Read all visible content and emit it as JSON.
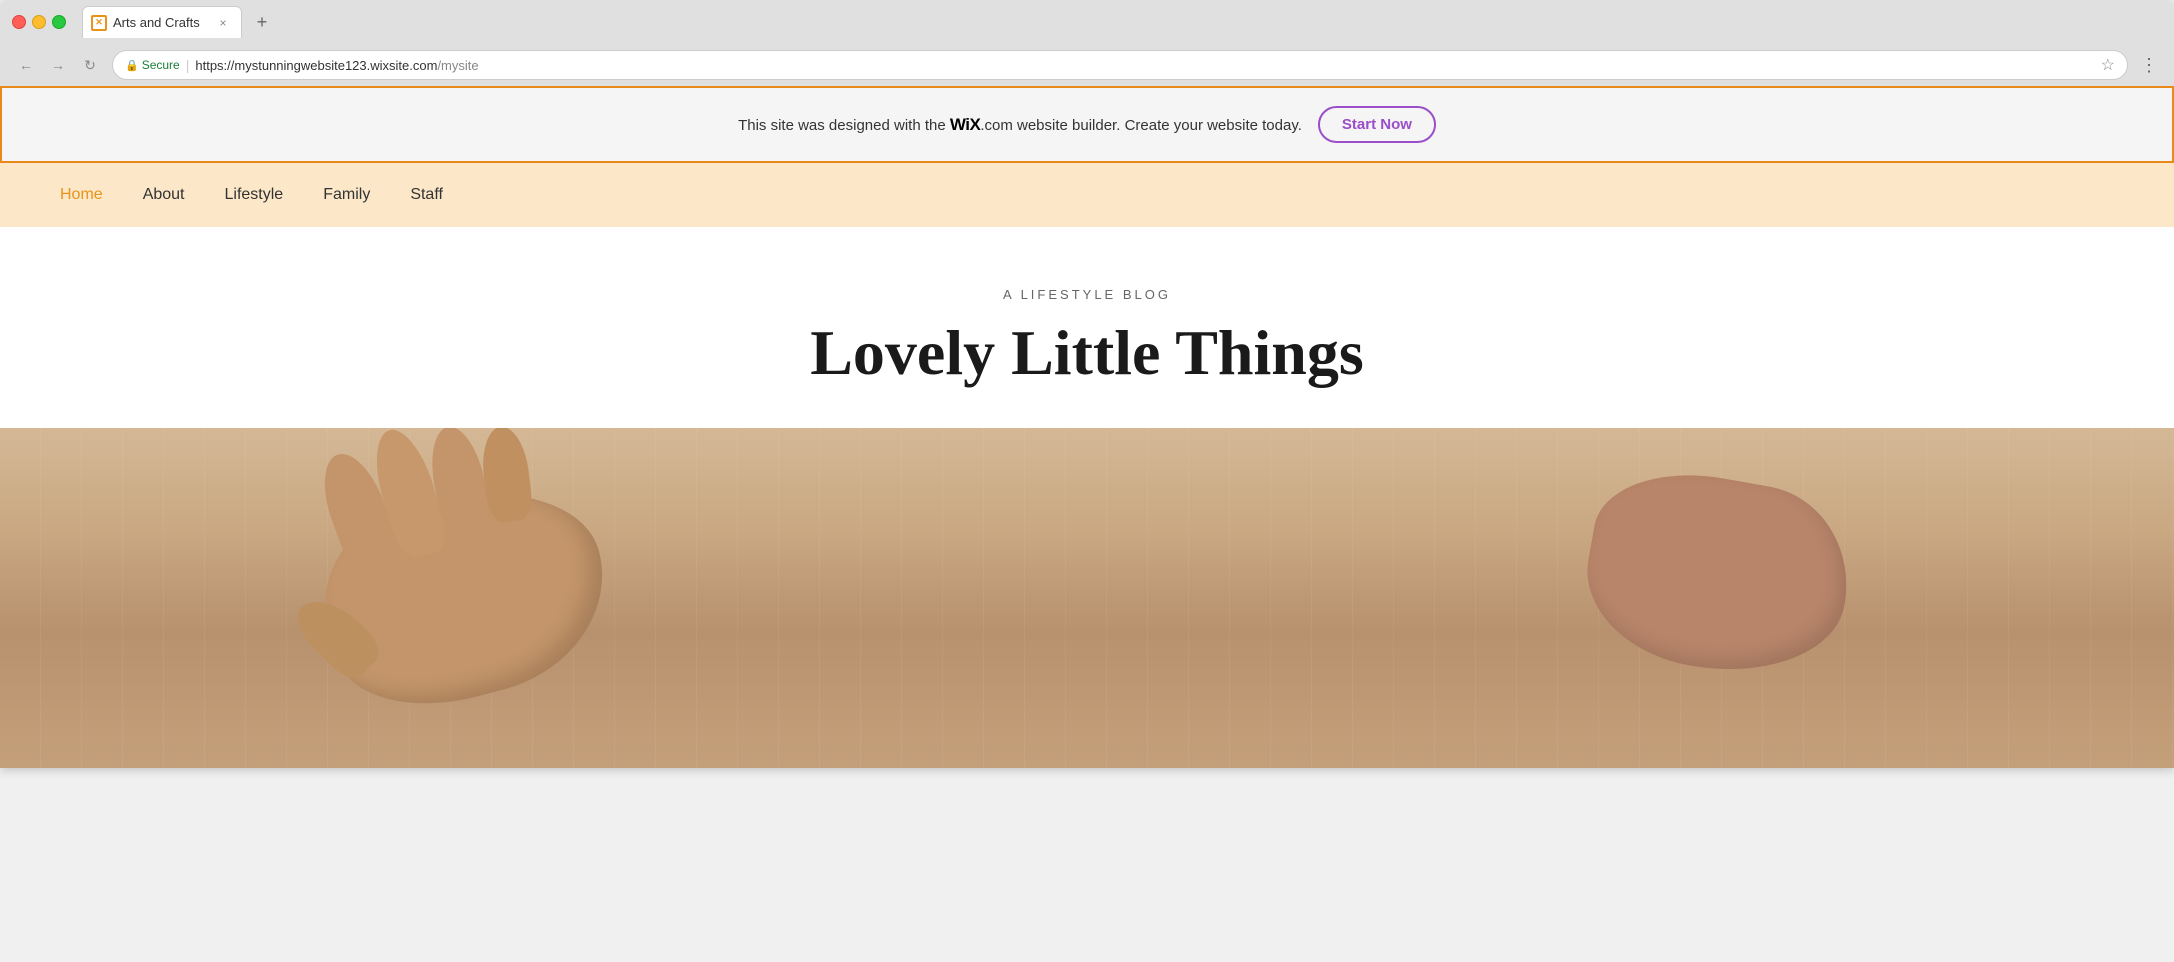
{
  "browser": {
    "tab_title": "Arts and Crafts",
    "tab_favicon": "✕",
    "close_btn": "×",
    "new_tab_btn": "+",
    "back_btn": "←",
    "forward_btn": "→",
    "refresh_btn": "↻",
    "secure_label": "Secure",
    "url_base": "https://mystunningwebsite123.wixsite.com",
    "url_path": "/mysite",
    "star_icon": "☆",
    "more_icon": "⋮"
  },
  "banner": {
    "text_before": "This site was designed with the ",
    "wix_brand": "WiX",
    "text_after": ".com website builder. Create your website today.",
    "start_now_label": "Start Now"
  },
  "nav": {
    "items": [
      {
        "label": "Home",
        "active": true
      },
      {
        "label": "About",
        "active": false
      },
      {
        "label": "Lifestyle",
        "active": false
      },
      {
        "label": "Family",
        "active": false
      },
      {
        "label": "Staff",
        "active": false
      }
    ]
  },
  "hero": {
    "subtitle": "A LIFESTYLE BLOG",
    "title": "Lovely Little Things"
  },
  "colors": {
    "nav_bg": "#fce8c8",
    "nav_active": "#e8931a",
    "banner_border": "#e8891a",
    "start_now_color": "#9b4dca",
    "title_color": "#1a1a1a"
  }
}
